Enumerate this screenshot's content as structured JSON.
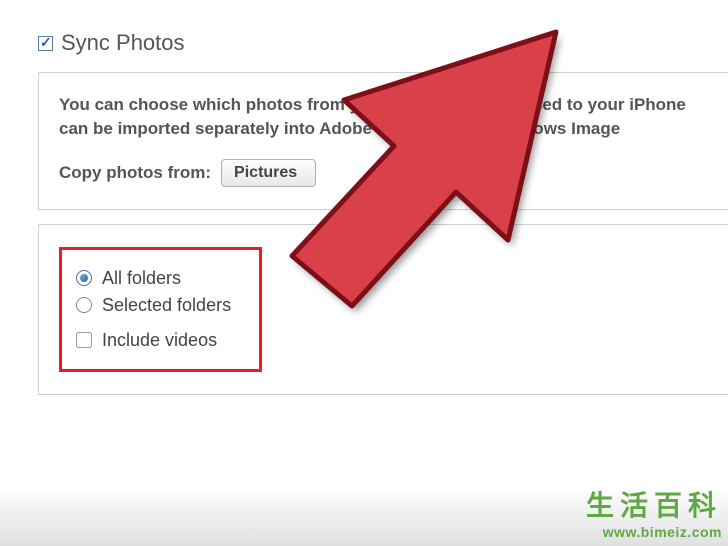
{
  "header": {
    "checked": true,
    "title": "Sync Photos"
  },
  "info": {
    "line1": "You can choose which photos from your computer are synced to your iPhone",
    "line2": "can be imported separately into Adobe Photoshop or Windows Image",
    "copy_label": "Copy photos from:",
    "dropdown_value": "Pictures"
  },
  "folders": {
    "all_label": "All folders",
    "selected_label": "Selected folders",
    "include_label": "Include videos"
  },
  "watermark": {
    "chinese": "生活百科",
    "url": "www.bimeiz.com"
  },
  "arrow": {
    "fill": "#d9414a",
    "stroke": "#7d0f18"
  }
}
